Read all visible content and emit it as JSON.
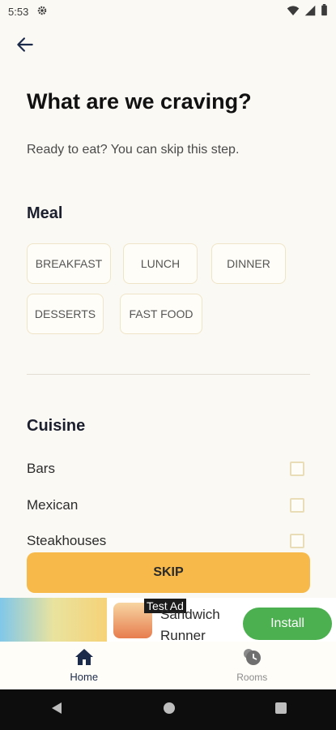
{
  "status": {
    "time": "5:53"
  },
  "header": {
    "title": "What are we craving?",
    "subtitle": "Ready to eat? You can skip this step."
  },
  "meal": {
    "title": "Meal",
    "chips": [
      "BREAKFAST",
      "LUNCH",
      "DINNER",
      "DESSERTS",
      "FAST FOOD"
    ]
  },
  "cuisine": {
    "title": "Cuisine",
    "items": [
      {
        "label": "Bars",
        "checked": false
      },
      {
        "label": "Mexican",
        "checked": false
      },
      {
        "label": "Steakhouses",
        "checked": false
      }
    ]
  },
  "actions": {
    "skip": "SKIP"
  },
  "ad": {
    "label": "Test Ad",
    "name": "Sandwich Runner",
    "install": "Install"
  },
  "nav": {
    "home": "Home",
    "rooms": "Rooms"
  },
  "colors": {
    "background": "#fbf9f3",
    "accent": "#f6b94a",
    "install": "#4caf50",
    "chip_border": "#efe4c8"
  }
}
